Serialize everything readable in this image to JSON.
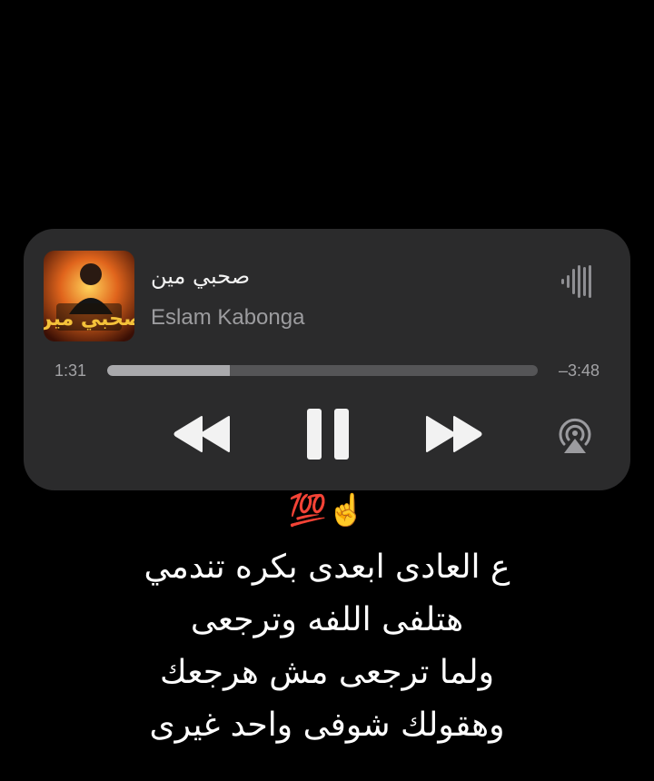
{
  "player": {
    "title": "صحبي مين",
    "artist": "Eslam Kabonga",
    "elapsed": "1:31",
    "remaining": "–3:48",
    "progress": 0.285,
    "icons": {
      "artwork": "album-artwork",
      "waveform": "waveform-icon",
      "rewind": "rewind-icon",
      "pause": "pause-icon",
      "forward": "fast-forward-icon",
      "airplay": "airplay-icon"
    }
  },
  "overlay": {
    "emoji": "💯☝️",
    "lyrics": [
      "ع العادى ابعدى بكره تندمي",
      "هتلفى اللفه وترجعى",
      "ولما ترجعى مش هرجعك",
      "وهقولك شوفى واحد غيرى"
    ]
  }
}
